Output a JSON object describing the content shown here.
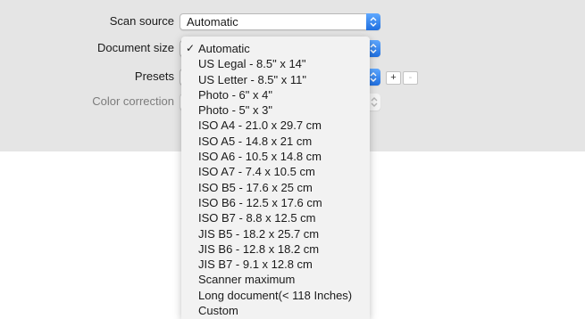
{
  "scan_source": {
    "label": "Scan source",
    "value": "Automatic"
  },
  "document_size": {
    "label": "Document size"
  },
  "presets": {
    "label": "Presets",
    "add_label": "+",
    "remove_label": "-"
  },
  "color_correction": {
    "label": "Color correction"
  },
  "menu": {
    "selected": "Automatic",
    "items": [
      "Automatic",
      "US Legal - 8.5\" x 14\"",
      "US Letter - 8.5\" x 11\"",
      "Photo - 6\" x 4\"",
      "Photo - 5\" x 3\"",
      "ISO A4 - 21.0 x 29.7 cm",
      "ISO A5 - 14.8 x 21 cm",
      "ISO A6 - 10.5 x 14.8 cm",
      "ISO A7 - 7.4 x 10.5 cm",
      "ISO B5 - 17.6 x 25 cm",
      "ISO B6 - 12.5 x 17.6 cm",
      "ISO B7 - 8.8 x 12.5 cm",
      "JIS B5 - 18.2 x 25.7 cm",
      "JIS B6 - 12.8 x 18.2 cm",
      "JIS B7 - 9.1 x 12.8 cm",
      "Scanner maximum",
      "Long document(< 118 Inches)",
      "Custom"
    ]
  },
  "colors": {
    "accent": "#2b7cf0",
    "panel": "#e5e5e5",
    "menu_bg": "#f2f2f2"
  }
}
